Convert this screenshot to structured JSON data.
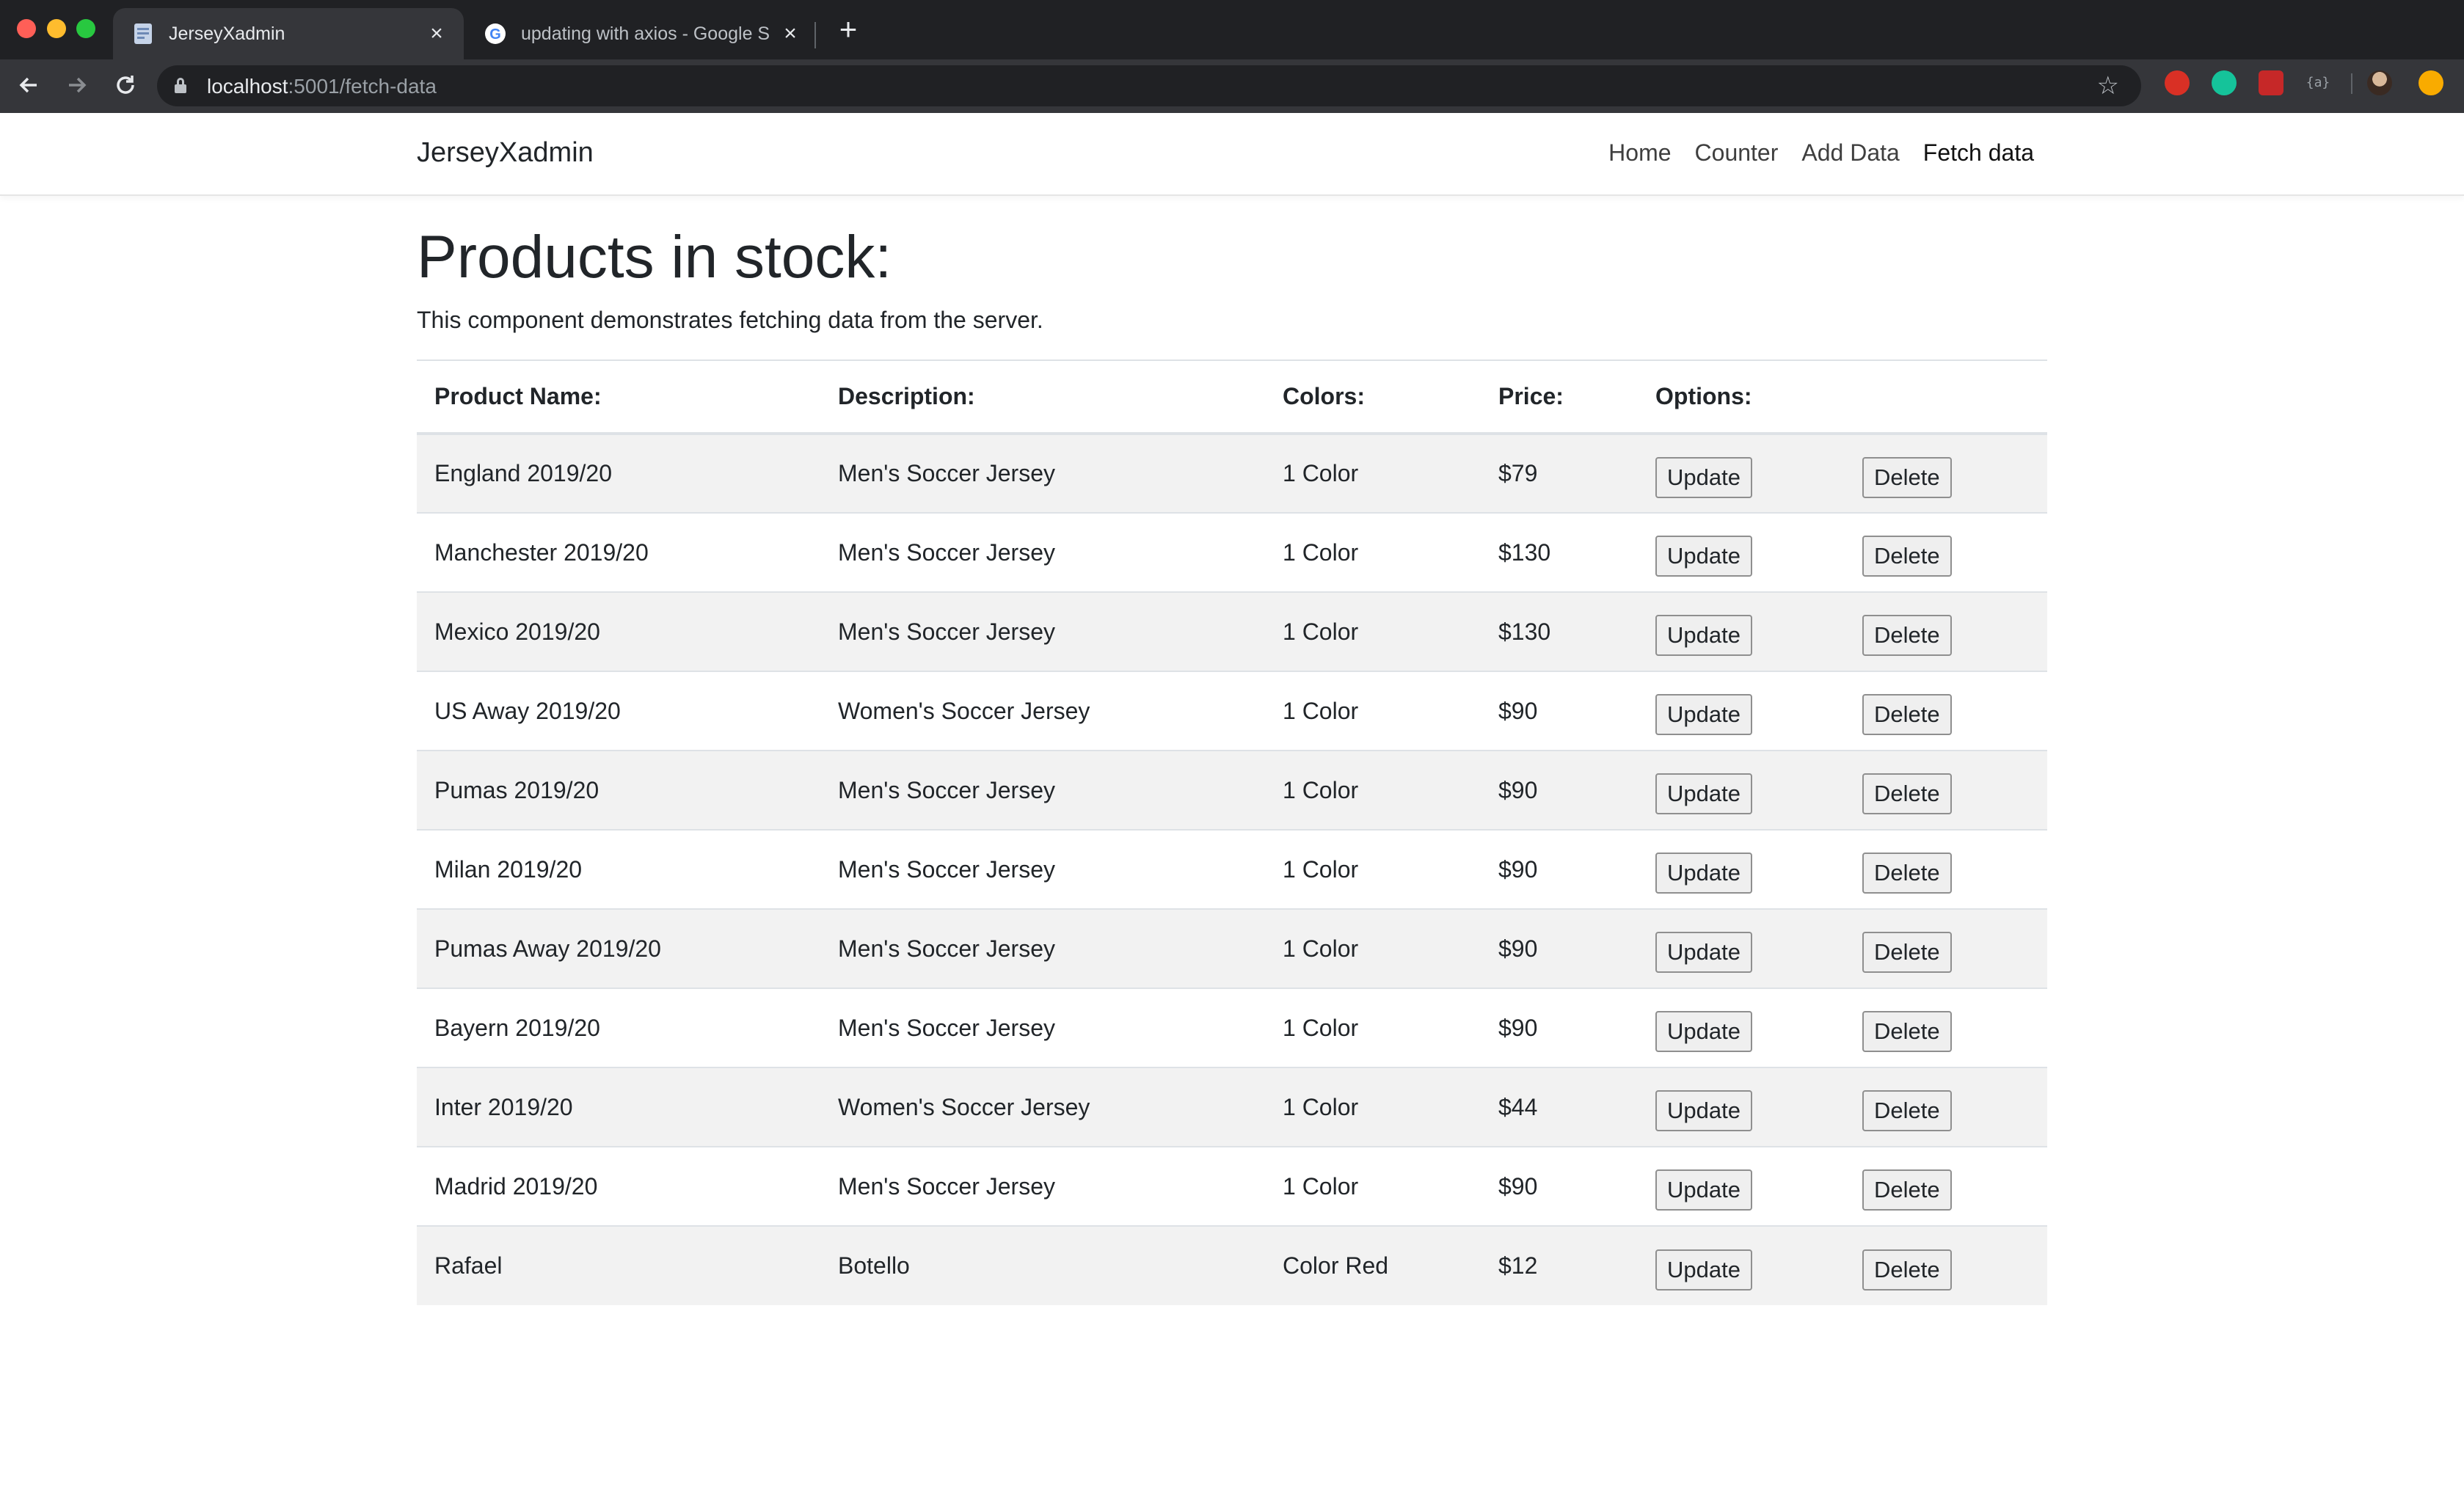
{
  "browser": {
    "tabs": [
      {
        "title": "JerseyXadmin",
        "active": true,
        "favicon": "page-icon"
      },
      {
        "title": "updating with axios - Google S",
        "active": false,
        "favicon": "google-icon"
      }
    ],
    "close_glyph": "×",
    "new_tab_glyph": "+",
    "url_host": "localhost",
    "url_path": ":5001/fetch-data",
    "icons": [
      "back-arrow-icon",
      "forward-arrow-icon",
      "reload-icon",
      "lock-icon",
      "star-icon"
    ],
    "extensions": [
      "adblock-icon",
      "grammarly-icon",
      "extension-icon",
      "json-viewer-icon",
      "profile-avatar-icon",
      "update-menu-icon"
    ],
    "extension_4_label": "{a}"
  },
  "navbar": {
    "brand": "JerseyXadmin",
    "links": [
      "Home",
      "Counter",
      "Add Data",
      "Fetch data"
    ],
    "active_link": "Fetch data"
  },
  "main": {
    "title": "Products in stock:",
    "subtitle": "This component demonstrates fetching data from the server.",
    "columns": [
      "Product Name:",
      "Description:",
      "Colors:",
      "Price:",
      "Options:"
    ],
    "update_label": "Update",
    "delete_label": "Delete",
    "rows": [
      [
        "England 2019/20",
        "Men's Soccer Jersey",
        "1 Color",
        "$79"
      ],
      [
        "Manchester 2019/20",
        "Men's Soccer Jersey",
        "1 Color",
        "$130"
      ],
      [
        "Mexico 2019/20",
        "Men's Soccer Jersey",
        "1 Color",
        "$130"
      ],
      [
        "US Away 2019/20",
        "Women's Soccer Jersey",
        "1 Color",
        "$90"
      ],
      [
        "Pumas 2019/20",
        "Men's Soccer Jersey",
        "1 Color",
        "$90"
      ],
      [
        "Milan 2019/20",
        "Men's Soccer Jersey",
        "1 Color",
        "$90"
      ],
      [
        "Pumas Away 2019/20",
        "Men's Soccer Jersey",
        "1 Color",
        "$90"
      ],
      [
        "Bayern 2019/20",
        "Men's Soccer Jersey",
        "1 Color",
        "$90"
      ],
      [
        "Inter 2019/20",
        "Women's Soccer Jersey",
        "1 Color",
        "$44"
      ],
      [
        "Madrid 2019/20",
        "Men's Soccer Jersey",
        "1 Color",
        "$90"
      ],
      [
        "Rafael",
        "Botello",
        "Color Red",
        "$12"
      ]
    ]
  },
  "colors": {
    "tabbar_bg": "#202124",
    "toolbar_bg": "#35363a",
    "striped_row": "#f2f2f2",
    "text": "#212529"
  }
}
